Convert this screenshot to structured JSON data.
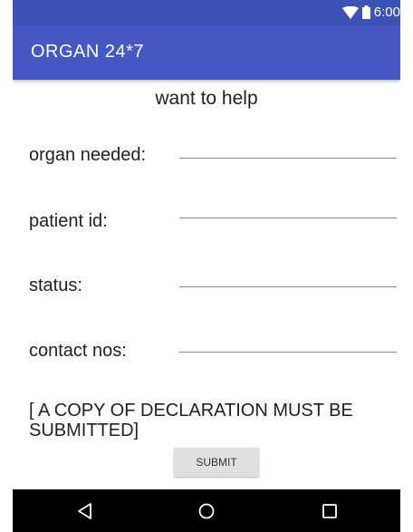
{
  "status_bar": {
    "time": "6:00",
    "icons": [
      "wifi-icon",
      "battery-icon"
    ]
  },
  "app_bar": {
    "title": "ORGAN 24*7"
  },
  "form": {
    "heading": "want to help",
    "fields": [
      {
        "label": "organ needed:",
        "value": ""
      },
      {
        "label": "patient id:",
        "value": ""
      },
      {
        "label": "status:",
        "value": ""
      },
      {
        "label": "contact nos:",
        "value": ""
      }
    ],
    "note": "[ A COPY OF DECLARATION MUST BE SUBMITTED]",
    "submit_label": "SUBMIT"
  },
  "nav_bar": {
    "icons": [
      "back-icon",
      "home-icon",
      "recents-icon"
    ]
  },
  "colors": {
    "status_bar": "#3d52b5",
    "app_bar": "#4457c4",
    "nav_bar": "#000000"
  }
}
